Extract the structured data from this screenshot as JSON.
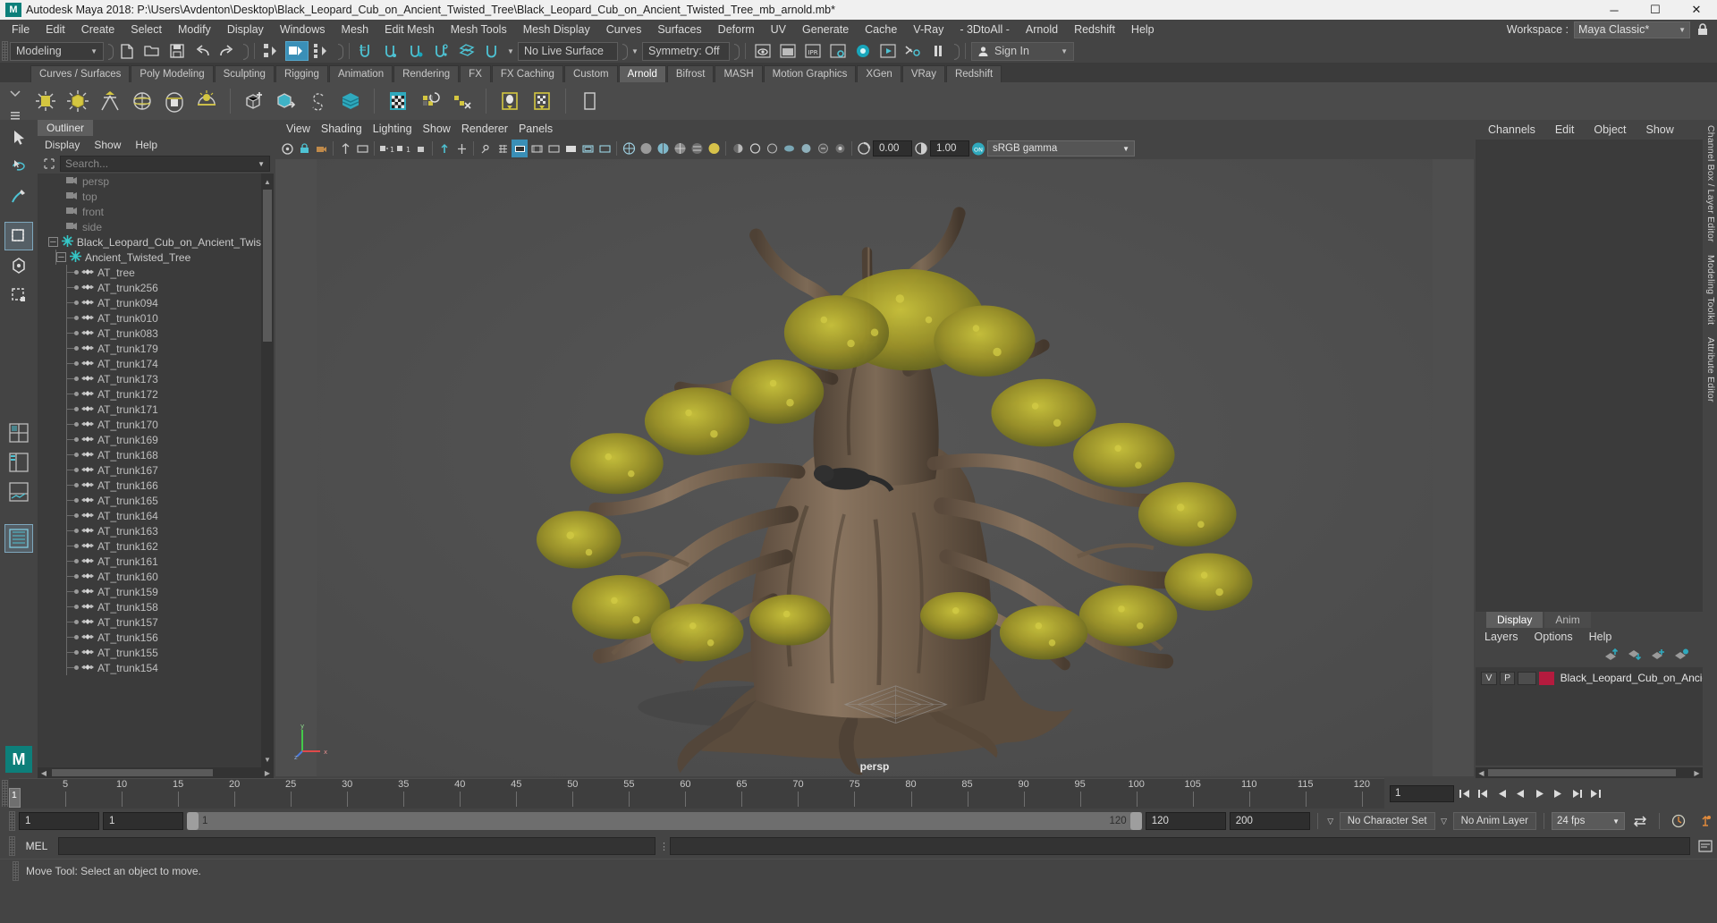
{
  "titlebar": {
    "app_title": "Autodesk Maya 2018: P:\\Users\\Avdenton\\Desktop\\Black_Leopard_Cub_on_Ancient_Twisted_Tree\\Black_Leopard_Cub_on_Ancient_Twisted_Tree_mb_arnold.mb*",
    "logo": "M",
    "minimize": "─",
    "maximize": "☐",
    "close": "✕"
  },
  "menubar": {
    "items": [
      "File",
      "Edit",
      "Create",
      "Select",
      "Modify",
      "Display",
      "Windows",
      "Mesh",
      "Edit Mesh",
      "Mesh Tools",
      "Mesh Display",
      "Curves",
      "Surfaces",
      "Deform",
      "UV",
      "Generate",
      "Cache",
      "V-Ray",
      "- 3DtoAll -",
      "Arnold",
      "Redshift",
      "Help"
    ],
    "workspace_label": "Workspace :",
    "workspace_value": "Maya Classic*",
    "lock_icon": "lock-icon"
  },
  "statusline": {
    "menuset": "Modeling",
    "live_surface": "No Live Surface",
    "symmetry": "Symmetry: Off",
    "sign_in": "Sign In"
  },
  "shelf": {
    "tabs": [
      "Curves / Surfaces",
      "Poly Modeling",
      "Sculpting",
      "Rigging",
      "Animation",
      "Rendering",
      "FX",
      "FX Caching",
      "Custom",
      "Arnold",
      "Bifrost",
      "MASH",
      "Motion Graphics",
      "XGen",
      "VRay",
      "Redshift"
    ],
    "active_tab": "Arnold",
    "icons": [
      "area-light-icon",
      "point-light-icon",
      "spot-light-icon",
      "skydome-light-icon",
      "mesh-light-icon",
      "physical-sky-icon",
      "create-standin-icon",
      "export-standin-icon",
      "volume-icon",
      "volume-shader-icon",
      "render-view-icon",
      "flush-cache-icon",
      "clear-cache-icon",
      "light-manager-icon",
      "tx-manager-icon"
    ]
  },
  "outliner": {
    "tab": "Outliner",
    "menu": [
      "Display",
      "Show",
      "Help"
    ],
    "search_placeholder": "Search...",
    "cameras": [
      "persp",
      "top",
      "front",
      "side"
    ],
    "root": "Black_Leopard_Cub_on_Ancient_Twis",
    "child_group": "Ancient_Twisted_Tree",
    "meshes": [
      "AT_tree",
      "AT_trunk256",
      "AT_trunk094",
      "AT_trunk010",
      "AT_trunk083",
      "AT_trunk179",
      "AT_trunk174",
      "AT_trunk173",
      "AT_trunk172",
      "AT_trunk171",
      "AT_trunk170",
      "AT_trunk169",
      "AT_trunk168",
      "AT_trunk167",
      "AT_trunk166",
      "AT_trunk165",
      "AT_trunk164",
      "AT_trunk163",
      "AT_trunk162",
      "AT_trunk161",
      "AT_trunk160",
      "AT_trunk159",
      "AT_trunk158",
      "AT_trunk157",
      "AT_trunk156",
      "AT_trunk155",
      "AT_trunk154"
    ]
  },
  "viewport": {
    "menu": [
      "View",
      "Shading",
      "Lighting",
      "Show",
      "Renderer",
      "Panels"
    ],
    "exposure": "0.00",
    "gamma": "1.00",
    "color_space": "sRGB gamma",
    "camera_label": "persp",
    "axis": {
      "x": "x",
      "y": "y",
      "z": "z"
    }
  },
  "channelbox": {
    "menu": [
      "Channels",
      "Edit",
      "Object",
      "Show"
    ],
    "rail": [
      "Channel Box / Layer Editor",
      "Modeling Toolkit",
      "Attribute Editor"
    ]
  },
  "layereditor": {
    "tabs": [
      "Display",
      "Anim"
    ],
    "active_tab": "Display",
    "menu": [
      "Layers",
      "Options",
      "Help"
    ],
    "buttons": [
      "move-layer-up-icon",
      "move-layer-down-icon",
      "new-layer-icon",
      "new-layer-from-selected-icon"
    ],
    "layers": [
      {
        "visible": "V",
        "playback": "P",
        "color": "#b41b3e",
        "name": "Black_Leopard_Cub_on_Ancien"
      }
    ]
  },
  "timeslider": {
    "current_frame": "1",
    "ticks": [
      5,
      10,
      15,
      20,
      25,
      30,
      35,
      40,
      45,
      50,
      55,
      60,
      65,
      70,
      75,
      80,
      85,
      90,
      95,
      100,
      105,
      110,
      115,
      120
    ],
    "range_start": 1,
    "range_end": 120,
    "field_value": "1",
    "playback_icons": [
      "go-to-start-icon",
      "step-back-key-icon",
      "step-back-frame-icon",
      "play-backwards-icon",
      "play-forwards-icon",
      "step-forward-frame-icon",
      "step-forward-key-icon",
      "go-to-end-icon"
    ]
  },
  "rangeslider": {
    "anim_start": "1",
    "range_start": "1",
    "bar_start": "1",
    "bar_end": "120",
    "range_end": "120",
    "anim_end": "200",
    "character_set": "No Character Set",
    "anim_layer": "No Anim Layer",
    "fps": "24 fps",
    "icons": [
      "auto-key-icon",
      "animation-preferences-icon",
      "loop-icon"
    ]
  },
  "commandline": {
    "language": "MEL",
    "input_value": "",
    "output_value": ""
  },
  "helpline": {
    "message": "Move Tool: Select an object to move."
  },
  "toolbox": {
    "tools": [
      "select-tool-icon",
      "lasso-select-tool-icon",
      "paint-select-tool-icon",
      "move-tool-icon",
      "rotate-tool-icon",
      "scale-tool-icon",
      "last-tool-icon",
      "four-view-layout-icon",
      "persp-outliner-layout-icon",
      "persp-graph-layout-icon",
      "single-perspective-view-icon"
    ],
    "active_tool": "move-tool-icon",
    "maya-logo": "M"
  }
}
